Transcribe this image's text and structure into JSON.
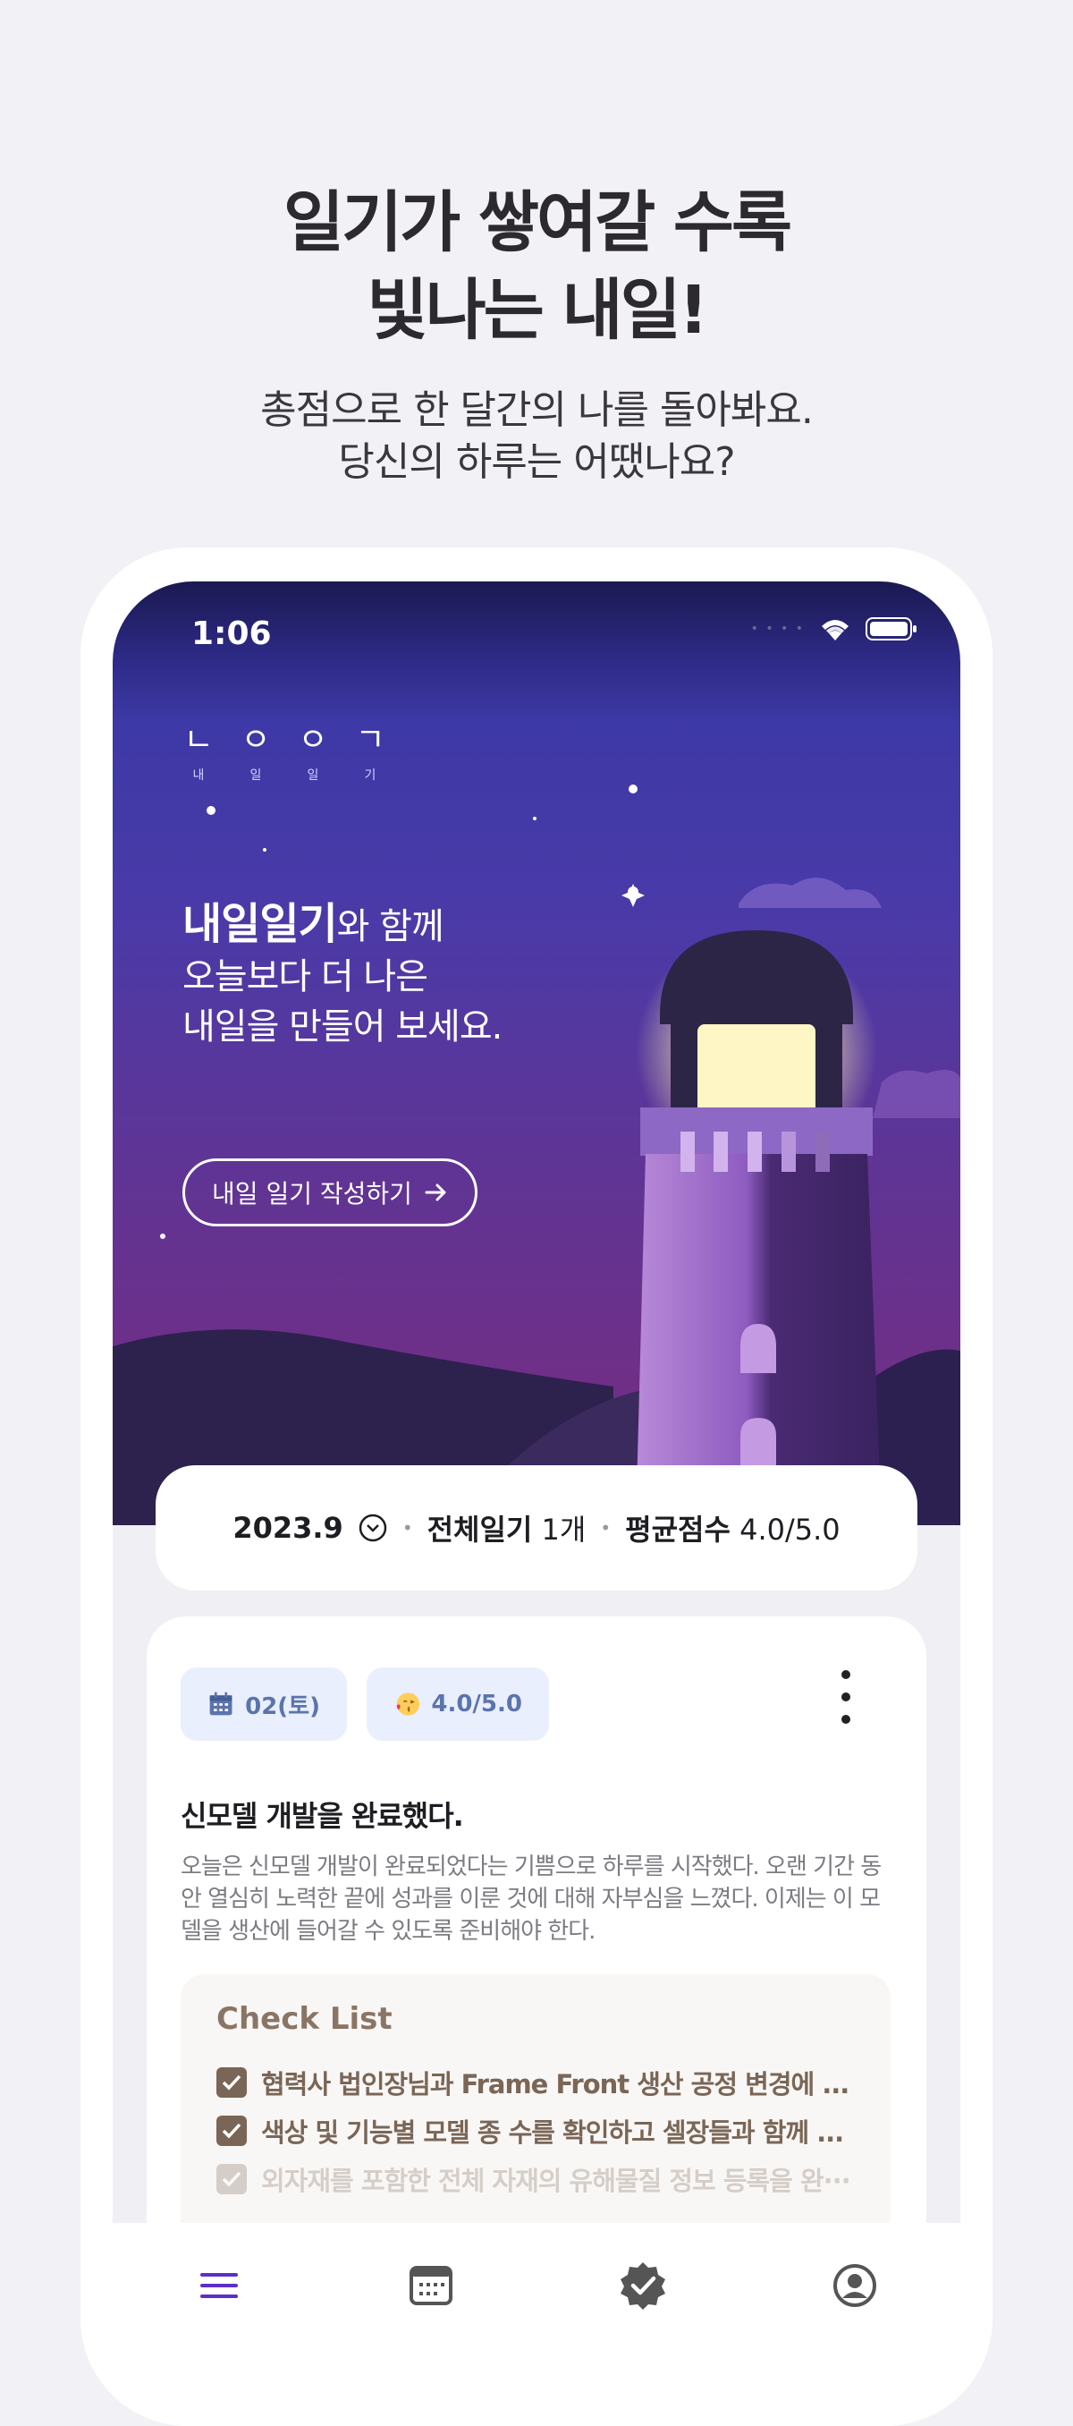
{
  "promo": {
    "headline_line1": "일기가 쌓여갈 수록",
    "headline_line2": "빛나는 내일!",
    "sub_line1": "총점으로 한 달간의 나를 돌아봐요.",
    "sub_line2": "당신의 하루는 어땠나요?"
  },
  "status_bar": {
    "time": "1:06"
  },
  "logo": {
    "glyphs": [
      "ㄴ",
      "ㅇ",
      "ㅇ",
      "ㄱ"
    ],
    "syllables": [
      "내",
      "일",
      "일",
      "기"
    ]
  },
  "hero": {
    "brand": "내일일기",
    "line1_rest": "와 함께",
    "line2": "오늘보다 더 나은",
    "line3": "내일을 만들어 보세요.",
    "write_button": "내일 일기 작성하기",
    "write_button_icon": "arrow-right-icon"
  },
  "summary": {
    "month": "2023.9",
    "total_label": "전체일기",
    "total_value": "1개",
    "avg_label": "평균점수",
    "avg_value": "4.0/5.0"
  },
  "entry": {
    "date": "02(토)",
    "score": "4.0/5.0",
    "title": "신모델 개발을 완료했다.",
    "body": "오늘은 신모델 개발이 완료되었다는 기쁨으로 하루를 시작했다. 오랜 기간 동안 열심히 노력한 끝에 성과를 이룬 것에 대해 자부심을 느꼈다. 이제는 이 모델을 생산에 들어갈 수 있도록 준비해야 한다.",
    "checklist_title": "Check List",
    "checklist": [
      "협력사 법인장님과 Frame Front 생산 공정 변경에 ...",
      "색상 및 기능별 모델 종 수를 확인하고 셀장들과 함께 ...",
      "외자재를 포함한 전체 자재의 유해물질 정보 등록을 완···"
    ]
  },
  "tabbar": {
    "icons": [
      "menu-icon",
      "calendar-icon",
      "badge-check-icon",
      "profile-icon"
    ]
  },
  "colors": {
    "accent": "#5b2fc9",
    "chip_bg": "#e9effc",
    "chip_text": "#5b74ad",
    "checklist_text": "#7a6656"
  }
}
